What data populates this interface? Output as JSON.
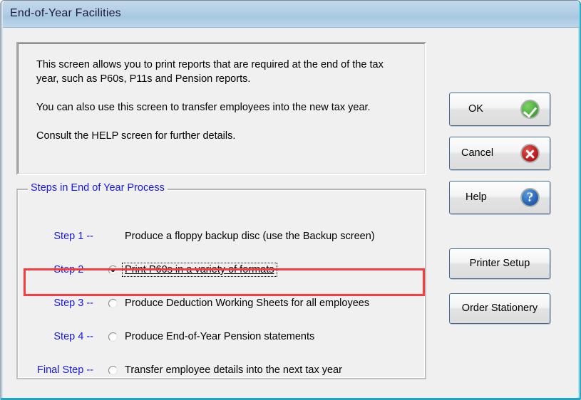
{
  "window": {
    "title": "End-of-Year Facilities"
  },
  "description": {
    "paragraphs": [
      "This screen allows you to print reports that are required at the end of the tax year, such as P60s, P11s and Pension reports.",
      "You can also use this screen to transfer employees into the new tax year.",
      "Consult the HELP screen for further details."
    ]
  },
  "steps_group": {
    "legend": "Steps in End of Year Process",
    "steps": [
      {
        "label": "Step 1 --",
        "description": "Produce a floppy backup disc (use the Backup screen)",
        "has_radio": false,
        "selected": false,
        "focused": false,
        "highlighted": false
      },
      {
        "label": "Step 2 --",
        "description": "Print P60s in a variety of formats",
        "has_radio": true,
        "selected": true,
        "focused": true,
        "highlighted": true
      },
      {
        "label": "Step 3 --",
        "description": "Produce Deduction Working Sheets for all employees",
        "has_radio": true,
        "selected": false,
        "focused": false,
        "highlighted": false
      },
      {
        "label": "Step 4 --",
        "description": "Produce End-of-Year Pension statements",
        "has_radio": true,
        "selected": false,
        "focused": false,
        "highlighted": false
      },
      {
        "label": "Final Step --",
        "description": "Transfer employee details into the next tax year",
        "has_radio": true,
        "selected": false,
        "focused": false,
        "highlighted": false
      }
    ]
  },
  "buttons": {
    "ok": {
      "label": "OK",
      "icon": "check-circle-icon"
    },
    "cancel": {
      "label": "Cancel",
      "icon": "x-circle-icon"
    },
    "help": {
      "label": "Help",
      "icon": "question-circle-icon",
      "glyph": "?"
    },
    "printer_setup": {
      "label": "Printer Setup"
    },
    "order_stationery": {
      "label": "Order Stationery"
    }
  },
  "colors": {
    "highlight_red": "#f93b3b",
    "step_label_blue": "#1818e0",
    "legend_blue": "#1818e0",
    "titlebar_blue": "#b4cfe6",
    "ok_green": "#4fae3c",
    "cancel_red": "#c21f1f",
    "help_blue": "#2b69b8"
  }
}
